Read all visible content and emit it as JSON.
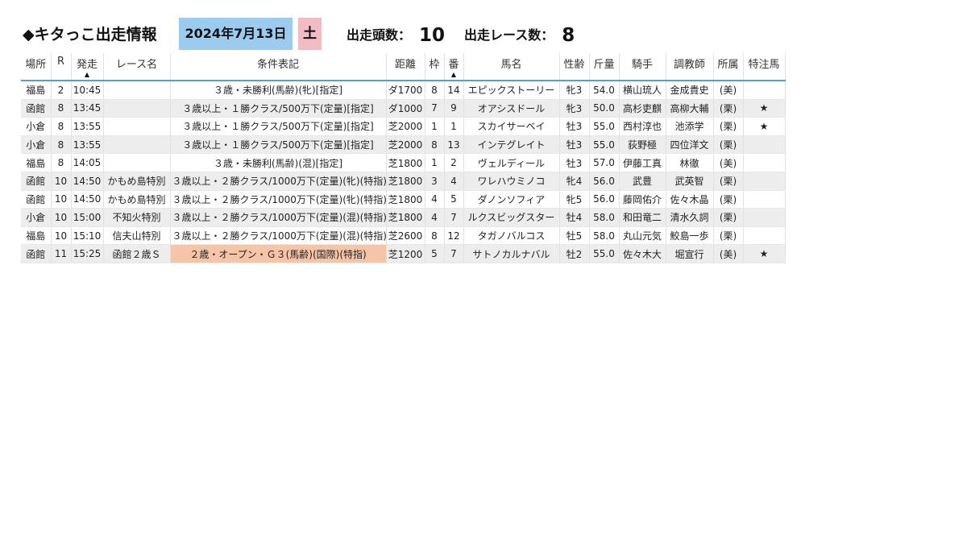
{
  "header": {
    "title": "◆キタっこ出走情報",
    "date": "2024年7月13日",
    "day_of_week": "土",
    "entries_label": "出走頭数：",
    "entries_value": "10",
    "races_label": "出走レース数：",
    "races_value": "8"
  },
  "table": {
    "columns": [
      "場所",
      "R",
      "発走",
      "レース名",
      "条件表記",
      "距離",
      "枠",
      "番",
      "馬名",
      "性齢",
      "斤量",
      "騎手",
      "調教師",
      "所属",
      "特注馬"
    ],
    "sort_indicator": "▲",
    "rows": [
      {
        "place": "福島",
        "r": "2",
        "time": "10:45",
        "race": "",
        "cond": "３歳・未勝利(馬齢)(牝)[指定]",
        "dist": "ダ1700",
        "waku": "8",
        "num": "14",
        "horse": "エピックストーリー",
        "sexage": "牝3",
        "weight": "54.0",
        "jockey": "横山琉人",
        "trainer": "金成貴史",
        "aff": "(美)",
        "star": ""
      },
      {
        "place": "函館",
        "r": "8",
        "time": "13:45",
        "race": "",
        "cond": "３歳以上・１勝クラス/500万下(定量)[指定]",
        "dist": "ダ1000",
        "waku": "7",
        "num": "9",
        "horse": "オアシスドール",
        "sexage": "牝3",
        "weight": "50.0",
        "jockey": "高杉吏麒",
        "trainer": "高柳大輔",
        "aff": "(栗)",
        "star": "★"
      },
      {
        "place": "小倉",
        "r": "8",
        "time": "13:55",
        "race": "",
        "cond": "３歳以上・１勝クラス/500万下(定量)[指定]",
        "dist": "芝2000",
        "waku": "1",
        "num": "1",
        "horse": "スカイサーベイ",
        "sexage": "牡3",
        "weight": "55.0",
        "jockey": "西村淳也",
        "trainer": "池添学",
        "aff": "(栗)",
        "star": "★"
      },
      {
        "place": "小倉",
        "r": "8",
        "time": "13:55",
        "race": "",
        "cond": "３歳以上・１勝クラス/500万下(定量)[指定]",
        "dist": "芝2000",
        "waku": "8",
        "num": "13",
        "horse": "インテグレイト",
        "sexage": "牡3",
        "weight": "55.0",
        "jockey": "荻野極",
        "trainer": "四位洋文",
        "aff": "(栗)",
        "star": ""
      },
      {
        "place": "福島",
        "r": "8",
        "time": "14:05",
        "race": "",
        "cond": "３歳・未勝利(馬齢)(混)[指定]",
        "dist": "芝1800",
        "waku": "1",
        "num": "2",
        "horse": "ヴェルディール",
        "sexage": "牡3",
        "weight": "57.0",
        "jockey": "伊藤工真",
        "trainer": "林徹",
        "aff": "(美)",
        "star": ""
      },
      {
        "place": "函館",
        "r": "10",
        "time": "14:50",
        "race": "かもめ島特別",
        "cond": "３歳以上・２勝クラス/1000万下(定量)(牝)(特指)",
        "dist": "芝1800",
        "waku": "3",
        "num": "4",
        "horse": "ワレハウミノコ",
        "sexage": "牝4",
        "weight": "56.0",
        "jockey": "武豊",
        "trainer": "武英智",
        "aff": "(栗)",
        "star": ""
      },
      {
        "place": "函館",
        "r": "10",
        "time": "14:50",
        "race": "かもめ島特別",
        "cond": "３歳以上・２勝クラス/1000万下(定量)(牝)(特指)",
        "dist": "芝1800",
        "waku": "4",
        "num": "5",
        "horse": "ダノンソフィア",
        "sexage": "牝5",
        "weight": "56.0",
        "jockey": "藤岡佑介",
        "trainer": "佐々木晶",
        "aff": "(栗)",
        "star": ""
      },
      {
        "place": "小倉",
        "r": "10",
        "time": "15:00",
        "race": "不知火特別",
        "cond": "３歳以上・２勝クラス/1000万下(定量)(混)(特指)",
        "dist": "芝1800",
        "waku": "4",
        "num": "7",
        "horse": "ルクスビッグスター",
        "sexage": "牡4",
        "weight": "58.0",
        "jockey": "和田竜二",
        "trainer": "清水久詞",
        "aff": "(栗)",
        "star": ""
      },
      {
        "place": "福島",
        "r": "10",
        "time": "15:10",
        "race": "信夫山特別",
        "cond": "３歳以上・２勝クラス/1000万下(定量)(混)(特指)",
        "dist": "芝2600",
        "waku": "8",
        "num": "12",
        "horse": "タガノバルコス",
        "sexage": "牡5",
        "weight": "58.0",
        "jockey": "丸山元気",
        "trainer": "鮫島一歩",
        "aff": "(栗)",
        "star": ""
      },
      {
        "place": "函館",
        "r": "11",
        "time": "15:25",
        "race": "函館２歳Ｓ",
        "cond": "２歳・オープン・Ｇ３(馬齢)(国際)(特指)",
        "dist": "芝1200",
        "waku": "5",
        "num": "7",
        "horse": "サトノカルナバル",
        "sexage": "牡2",
        "weight": "55.0",
        "jockey": "佐々木大",
        "trainer": "堀宣行",
        "aff": "(美)",
        "star": "★"
      }
    ]
  },
  "colors": {
    "date_box": "#9ccbf0",
    "dow_box": "#f1bcc4",
    "highlight_cond": "#f6c5a8",
    "header_rule": "#5c9cc8",
    "row_stripe": "#ededed"
  }
}
